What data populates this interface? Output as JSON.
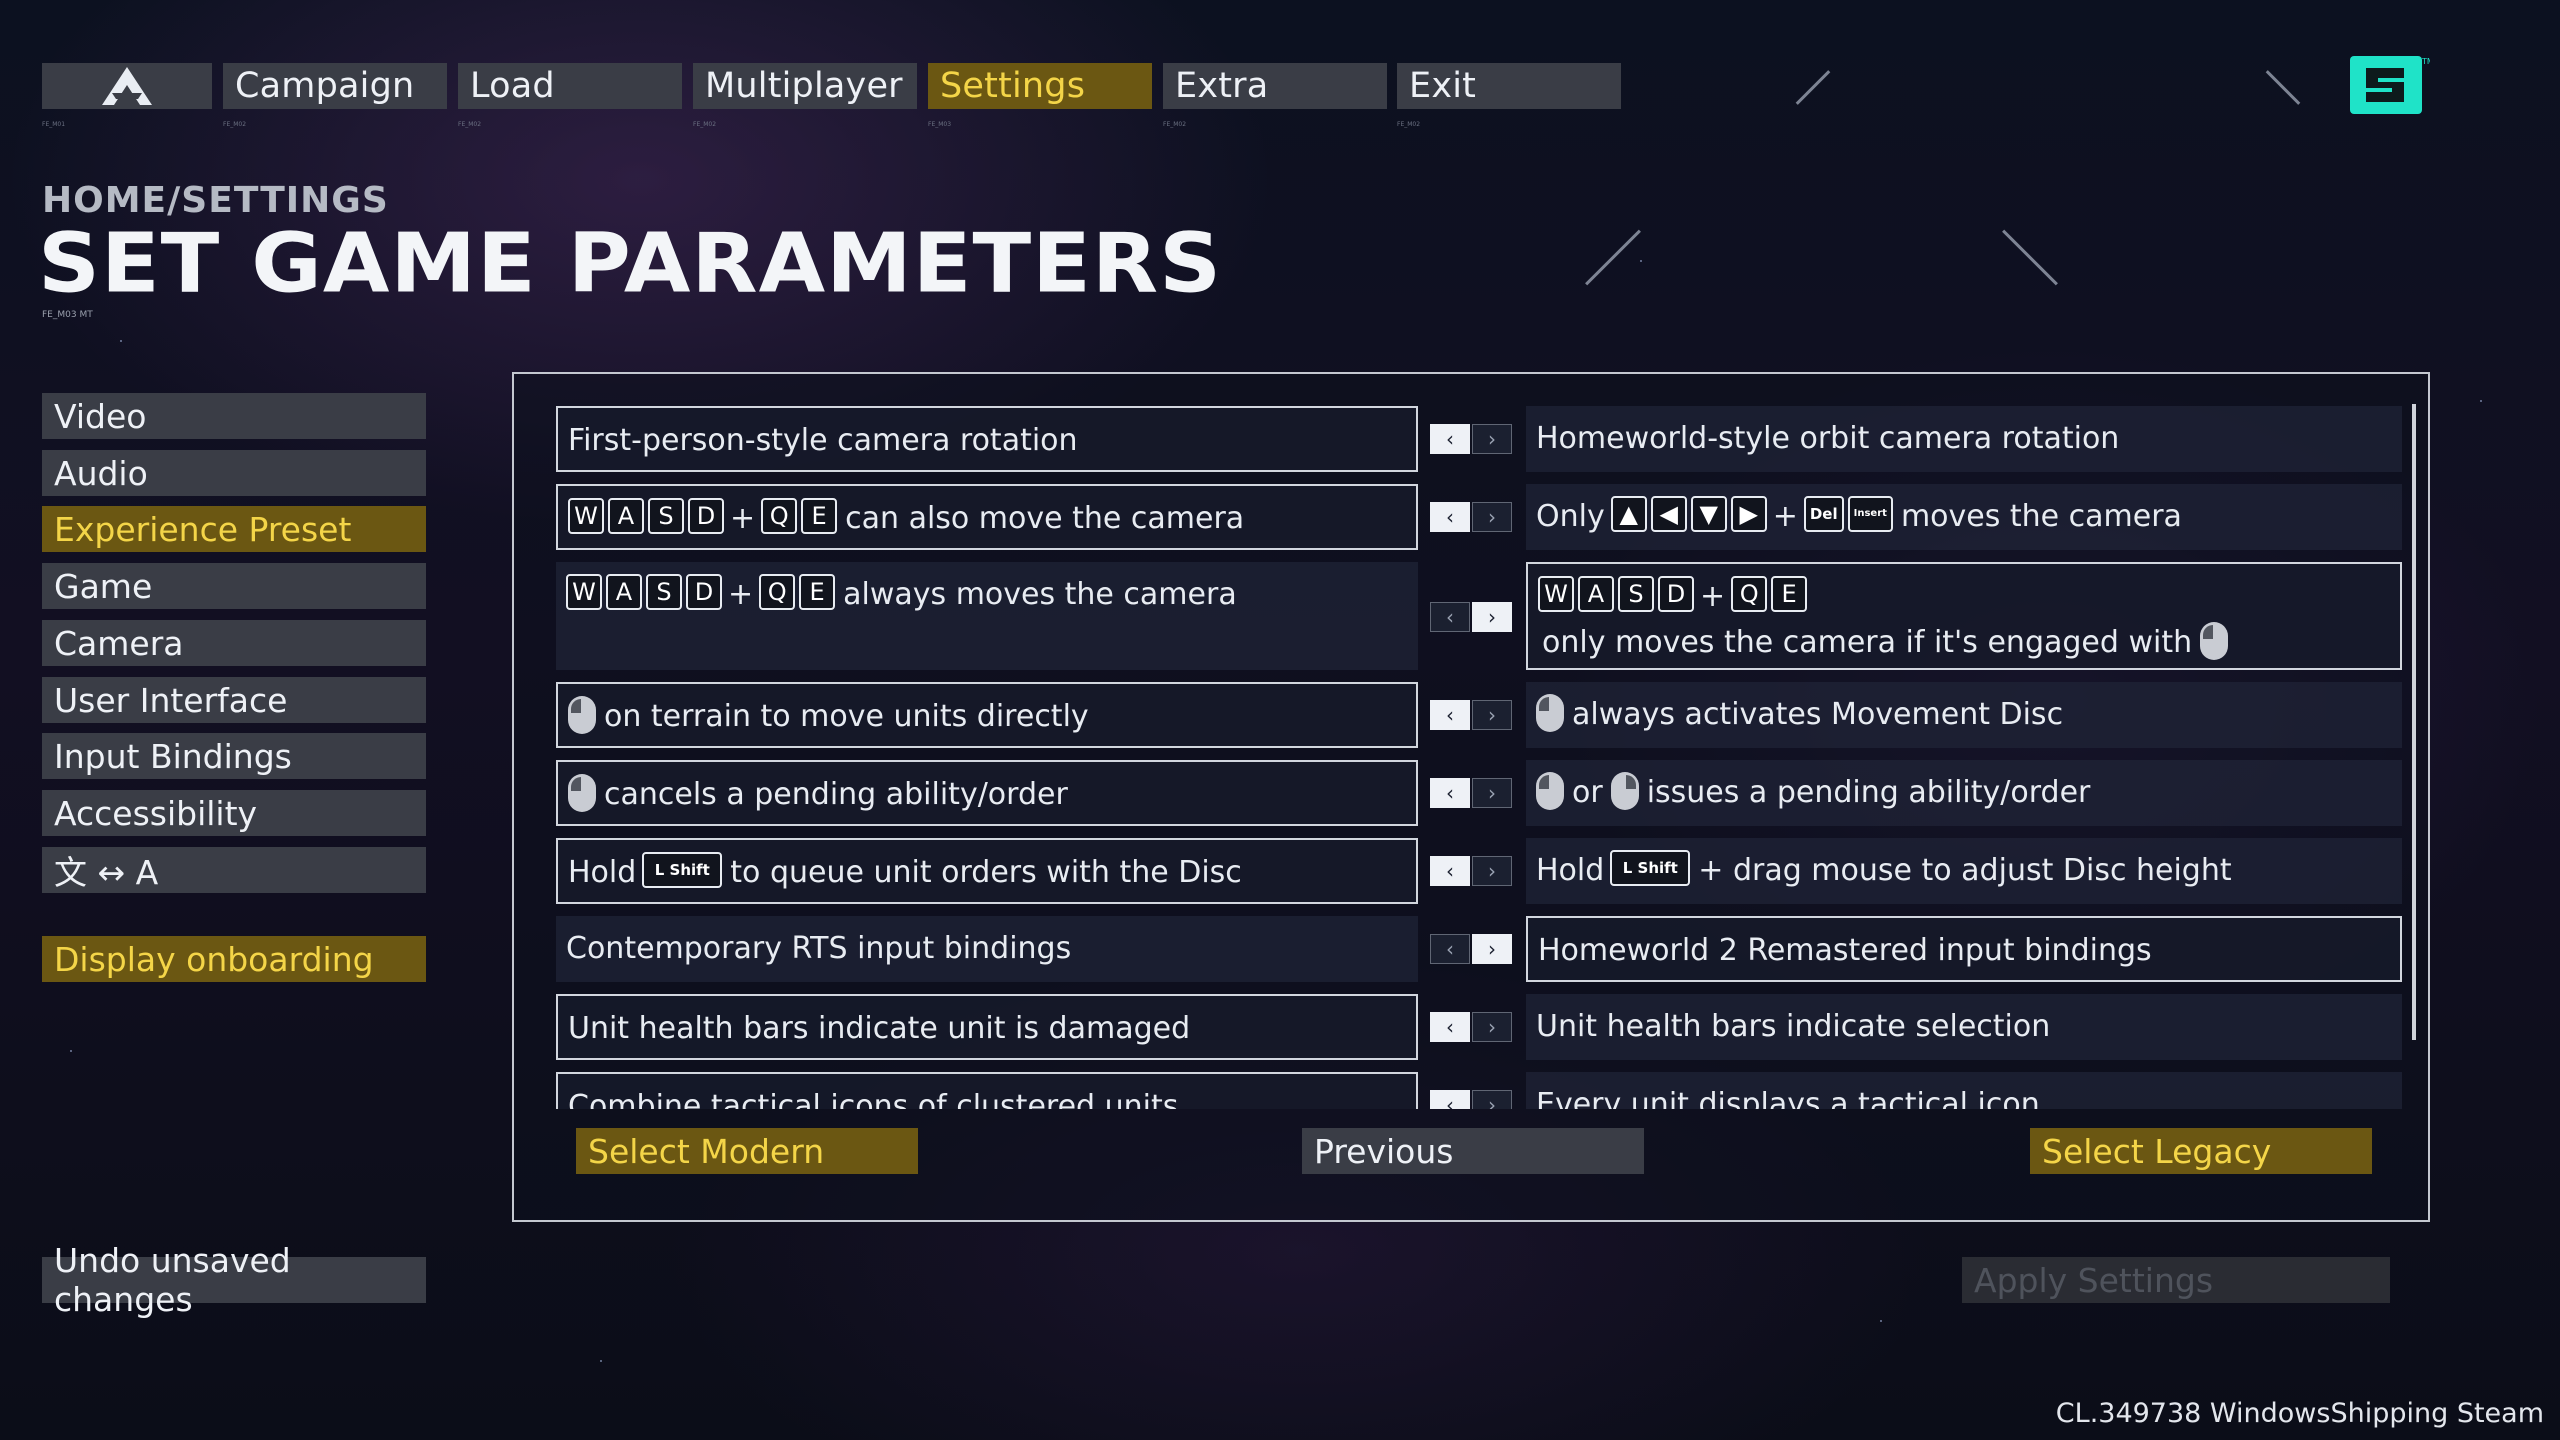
{
  "nav": {
    "items": [
      {
        "label": "Campaign",
        "code": "FE_M02"
      },
      {
        "label": "Load",
        "code": "FE_M02"
      },
      {
        "label": "Multiplayer",
        "code": "FE_M02"
      },
      {
        "label": "Settings",
        "code": "FE_M03"
      },
      {
        "label": "Extra",
        "code": "FE_M02"
      },
      {
        "label": "Exit",
        "code": "FE_M02"
      }
    ],
    "active": "Settings"
  },
  "header": {
    "breadcrumb": "HOME/SETTINGS",
    "title": "SET GAME PARAMETERS",
    "code": "FE_M03 MT"
  },
  "sidebar": {
    "items": [
      {
        "label": "Video"
      },
      {
        "label": "Audio"
      },
      {
        "label": "Experience Preset"
      },
      {
        "label": "Game"
      },
      {
        "label": "Camera"
      },
      {
        "label": "User Interface"
      },
      {
        "label": "Input Bindings"
      },
      {
        "label": "Accessibility"
      },
      {
        "label": "文 ↔ A"
      }
    ],
    "active": "Experience Preset",
    "onboarding": "Display onboarding",
    "undo": "Undo unsaved changes"
  },
  "apply_button": "Apply Settings",
  "presets": {
    "rows": [
      {
        "left": "First-person-style camera rotation",
        "right": "Homeworld-style orbit camera rotation",
        "selected": "left"
      },
      {
        "left_keys": [
          "W",
          "A",
          "S",
          "D",
          "+",
          "Q",
          "E"
        ],
        "left": "can also move the camera",
        "right_prefix": "Only",
        "right_keys": [
          "▲",
          "◀",
          "▼",
          "▶",
          "+",
          "Del",
          "Insert"
        ],
        "right": "moves the camera",
        "selected": "left"
      },
      {
        "left_keys": [
          "W",
          "A",
          "S",
          "D",
          "+",
          "Q",
          "E"
        ],
        "left": "always moves the camera",
        "right_keys": [
          "W",
          "A",
          "S",
          "D",
          "+",
          "Q",
          "E"
        ],
        "right": "only moves the camera if it's engaged with",
        "selected": "right"
      },
      {
        "left": "on terrain to move units directly",
        "right": "always activates Movement Disc",
        "selected": "left"
      },
      {
        "left": "cancels a pending ability/order",
        "right_mid": "or",
        "right": "issues a pending ability/order",
        "selected": "left"
      },
      {
        "left_prefix": "Hold",
        "left_key": "L Shift",
        "left": "to queue unit orders with the Disc",
        "right_prefix": "Hold",
        "right_key": "L Shift",
        "right": "+ drag mouse to adjust Disc height",
        "selected": "left"
      },
      {
        "left": "Contemporary RTS input bindings",
        "right": "Homeworld 2 Remastered input bindings",
        "selected": "right"
      },
      {
        "left": "Unit health bars indicate unit is damaged",
        "right": "Unit health bars indicate selection",
        "selected": "left"
      },
      {
        "left": "Combine tactical icons of clustered units",
        "right": "Every unit displays a tactical icon",
        "selected": "left"
      }
    ]
  },
  "footer": {
    "select_modern": "Select Modern",
    "previous": "Previous",
    "select_legacy": "Select Legacy"
  },
  "version": "CL.349738 WindowsShipping Steam",
  "colors": {
    "accent": "#f4d548",
    "accent_bg": "#6b5712",
    "button_bg": "#3a3d46",
    "brand": "#1fe3c8"
  }
}
